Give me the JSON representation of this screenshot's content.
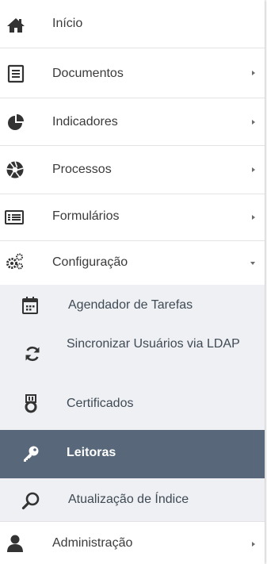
{
  "menu": {
    "items": [
      {
        "label": "Início",
        "icon": "home-icon"
      },
      {
        "label": "Documentos",
        "icon": "document-icon"
      },
      {
        "label": "Indicadores",
        "icon": "pie-chart-icon"
      },
      {
        "label": "Processos",
        "icon": "aperture-icon"
      },
      {
        "label": "Formulários",
        "icon": "form-list-icon"
      },
      {
        "label": "Configuração",
        "icon": "cogs-icon",
        "expanded": true
      },
      {
        "label": "Administração",
        "icon": "user-icon"
      }
    ],
    "subitems": [
      {
        "label": "Agendador de Tarefas",
        "icon": "calendar-icon"
      },
      {
        "label": "Sincronizar Usuários via LDAP",
        "icon": "sync-icon"
      },
      {
        "label": "Certificados",
        "icon": "medal-icon"
      },
      {
        "label": "Leitoras",
        "icon": "key-icon",
        "active": true
      },
      {
        "label": "Atualização de Índice",
        "icon": "search-icon"
      }
    ]
  },
  "colors": {
    "active_bg": "#58687a",
    "submenu_bg": "#eef0f3",
    "icon_dark": "#333333"
  }
}
